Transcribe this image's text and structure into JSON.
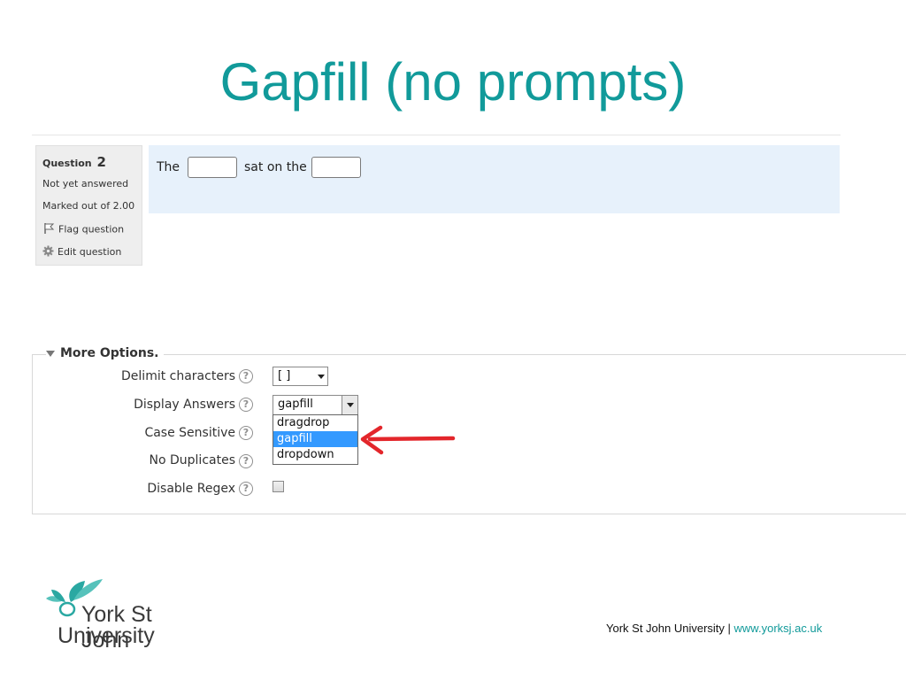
{
  "slide": {
    "title": "Gapfill (no prompts)"
  },
  "question_info": {
    "question_label": "Question",
    "question_number": "2",
    "state": "Not yet answered",
    "marks": "Marked out of 2.00",
    "flag_label": "Flag question",
    "edit_label": "Edit question"
  },
  "question_content": {
    "word_1": "The",
    "word_2": "sat on the"
  },
  "more_options": {
    "legend": "More Options.",
    "delimit": {
      "label": "Delimit characters",
      "value": "[ ]"
    },
    "display_answers": {
      "label": "Display Answers",
      "value": "gapfill",
      "options": [
        "dragdrop",
        "gapfill",
        "dropdown"
      ],
      "highlighted": "gapfill"
    },
    "case_sensitive": {
      "label": "Case Sensitive"
    },
    "no_duplicates": {
      "label": "No Duplicates"
    },
    "disable_regex": {
      "label": "Disable Regex",
      "checked": false
    },
    "help_glyph": "?"
  },
  "colors": {
    "title_teal": "#119a9a",
    "question_bg": "#e7f1fb",
    "highlight_blue": "#3399ff",
    "arrow_red": "#e3262b"
  },
  "footer": {
    "logo_line_1": "York St John",
    "logo_line_2": "University",
    "university": "York St John University",
    "separator": " | ",
    "url": "www.yorksj.ac.uk"
  }
}
